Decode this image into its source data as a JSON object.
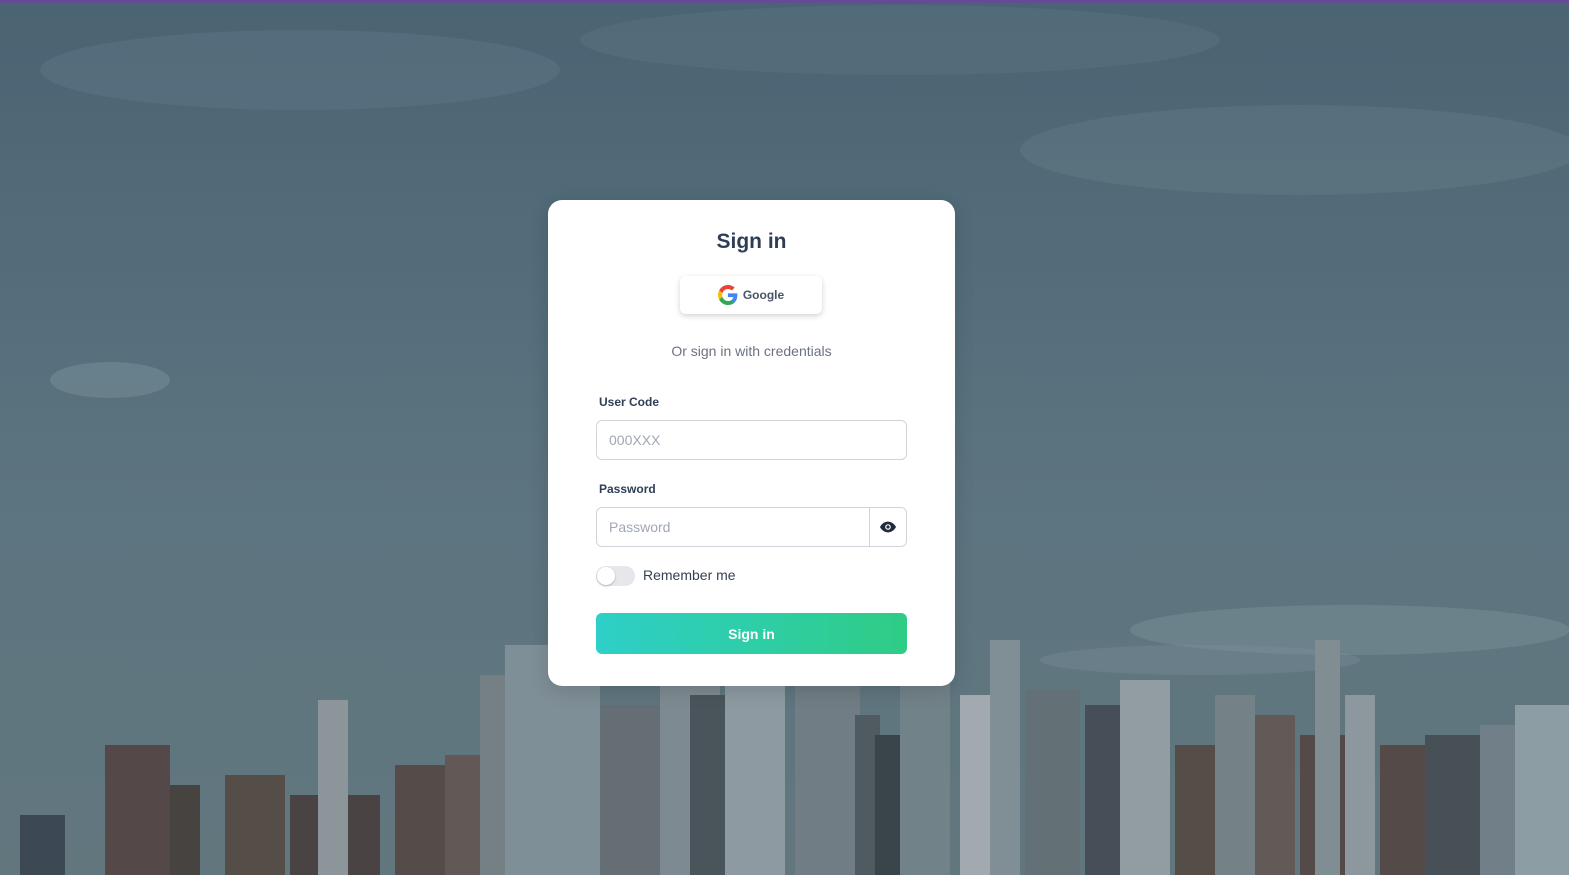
{
  "login": {
    "title": "Sign in",
    "google_label": "Google",
    "alt_text": "Or sign in with credentials",
    "user_code_label": "User Code",
    "user_code_placeholder": "000XXX",
    "password_label": "Password",
    "password_placeholder": "Password",
    "remember_label": "Remember me",
    "remember_checked": false,
    "submit_label": "Sign in"
  },
  "icons": {
    "google": "google-logo-icon",
    "show_password": "eye-icon"
  },
  "colors": {
    "accent_start": "#2ecfc8",
    "accent_end": "#2fcc86",
    "top_bar": "#6b4fa0",
    "title_text": "#2f3e56"
  }
}
